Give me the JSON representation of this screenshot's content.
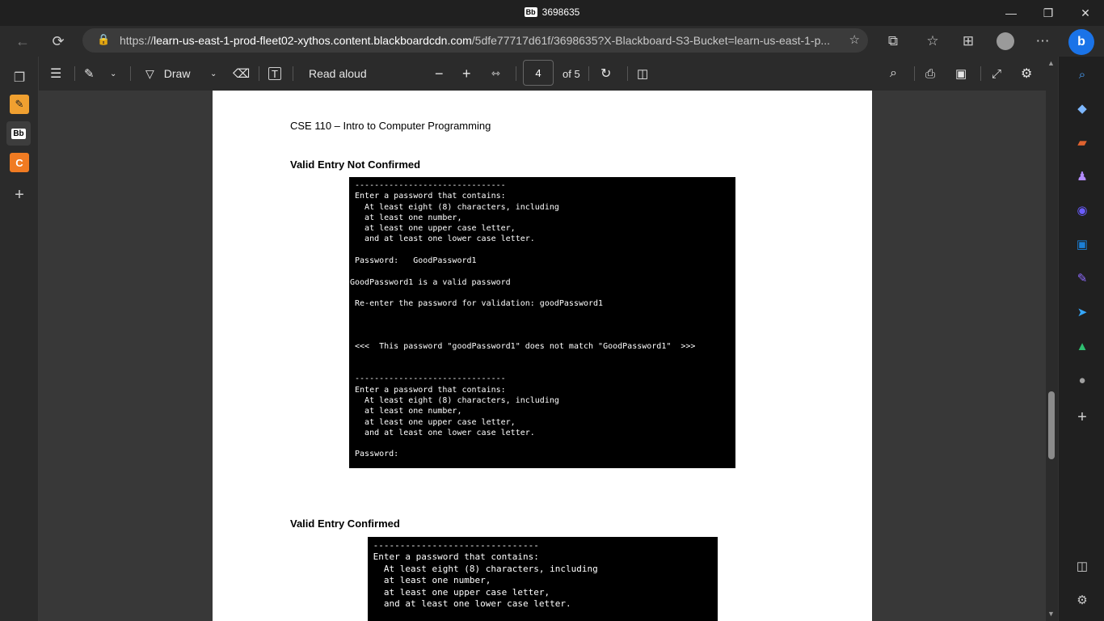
{
  "window": {
    "tab_logo": "Bb",
    "title": "3698635",
    "minimize": "—",
    "maximize": "❐",
    "close": "✕"
  },
  "addressbar": {
    "url_prefix": "https://",
    "url_host": "learn-us-east-1-prod-fleet02-xythos.content.blackboardcdn.com",
    "url_path": "/5dfe77717d61f/3698635?X-Blackboard-S3-Bucket=learn-us-east-1-p..."
  },
  "sidebar_left": {
    "items": [
      {
        "icon": "tabs-icon",
        "glyph": "❐"
      },
      {
        "icon": "notes-app-icon",
        "glyph": "✎"
      },
      {
        "icon": "blackboard-icon",
        "glyph": "Bb"
      },
      {
        "icon": "c-app-icon",
        "glyph": "C"
      },
      {
        "icon": "add-icon",
        "glyph": "+"
      }
    ]
  },
  "pdf_toolbar": {
    "draw_label": "Draw",
    "read_aloud_label": "Read aloud",
    "page_current": "4",
    "page_total": "of 5"
  },
  "document": {
    "header": "CSE 110 – Intro to Computer Programming",
    "section1_title": "Valid Entry Not Confirmed",
    "terminal1_lines": [
      " -------------------------------",
      " Enter a password that contains:",
      "   At least eight (8) characters, including",
      "   at least one number,",
      "   at least one upper case letter,",
      "   and at least one lower case letter.",
      "",
      " Password:   GoodPassword1",
      "",
      "GoodPassword1 is a valid password",
      "",
      " Re-enter the password for validation: goodPassword1",
      "",
      "",
      "",
      " <<<  This password \"goodPassword1\" does not match \"GoodPassword1\"  >>>",
      "",
      "",
      " -------------------------------",
      " Enter a password that contains:",
      "   At least eight (8) characters, including",
      "   at least one number,",
      "   at least one upper case letter,",
      "   and at least one lower case letter.",
      "",
      " Password:"
    ],
    "section2_title": "Valid Entry Confirmed",
    "terminal2_lines": [
      " -------------------------------",
      " Enter a password that contains:",
      "   At least eight (8) characters, including",
      "   at least one number,",
      "   at least one upper case letter,",
      "   and at least one lower case letter."
    ]
  },
  "sidebar_right": {
    "colors": [
      "#4aa3ff",
      "#7db7ff",
      "#e0632f",
      "#b38cff",
      "#6a5cff",
      "#1c7fd6",
      "#8f6bff",
      "#35a7ff",
      "#2fbf71",
      "#a0a0a0"
    ]
  }
}
